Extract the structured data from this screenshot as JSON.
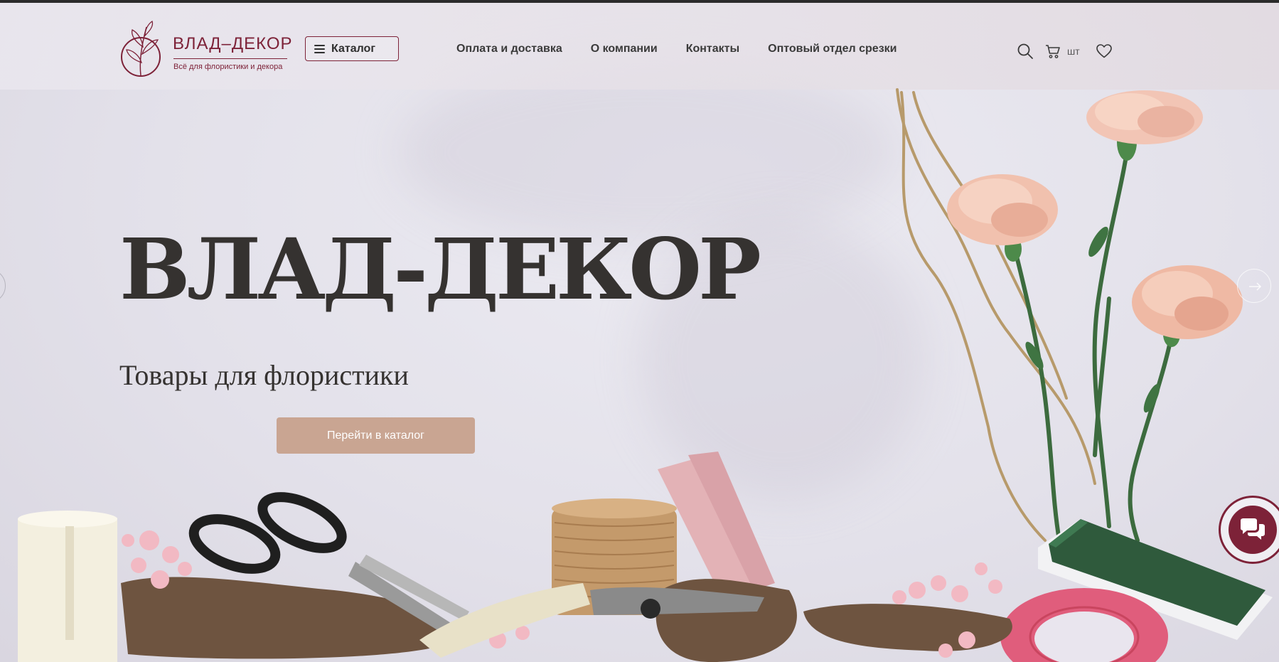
{
  "header": {
    "logo": {
      "title": "ВЛАД–ДЕКОР",
      "subtitle": "Всё для флористики и декора"
    },
    "catalog_button": "Каталог",
    "nav": [
      "Оплата и доставка",
      "О компании",
      "Контакты",
      "Оптовый отдел срезки"
    ],
    "icons": [
      "search-icon",
      "cart-icon",
      "heart-icon"
    ],
    "cart_count": "шт"
  },
  "hero": {
    "title": "ВЛАД-ДЕКОР",
    "subtitle": "Товары для флористики",
    "cta": "Перейти в каталог"
  },
  "colors": {
    "brand": "#7d2238",
    "cta": "#c9a592",
    "text": "#353230"
  }
}
